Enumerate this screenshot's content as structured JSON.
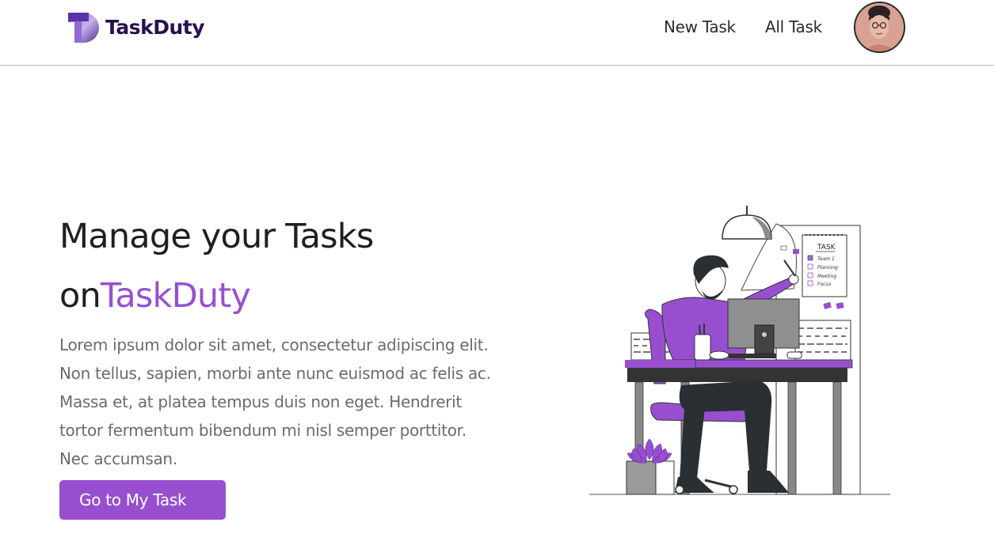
{
  "navbar": {
    "brand_name": "TaskDuty",
    "brand_icon": "taskduty-logo-icon",
    "links": [
      {
        "label": "New Task"
      },
      {
        "label": "All Task"
      }
    ],
    "avatar_icon": "user-avatar"
  },
  "hero": {
    "title_line1": "Manage your Tasks",
    "title_prefix": "on",
    "title_accent": "TaskDuty",
    "description": "Lorem ipsum dolor sit amet, consectetur adipiscing elit. Non tellus, sapien, morbi ante nunc euismod ac felis ac. Massa et, at platea tempus duis non eget. Hendrerit tortor fermentum bibendum mi nisl semper porttitor. Nec accumsan.",
    "cta_label": "Go to My Task"
  },
  "illustration": {
    "icon": "person-at-desk-illustration",
    "checklist_title": "TASK",
    "checklist_items": [
      "Team 1",
      "Planning",
      "Meeting",
      "Focus"
    ]
  },
  "colors": {
    "accent": "#974fd0",
    "brand_dark": "#2a0f4f",
    "text_dark": "#1f1f1f",
    "text_muted": "#6b6b6b"
  }
}
